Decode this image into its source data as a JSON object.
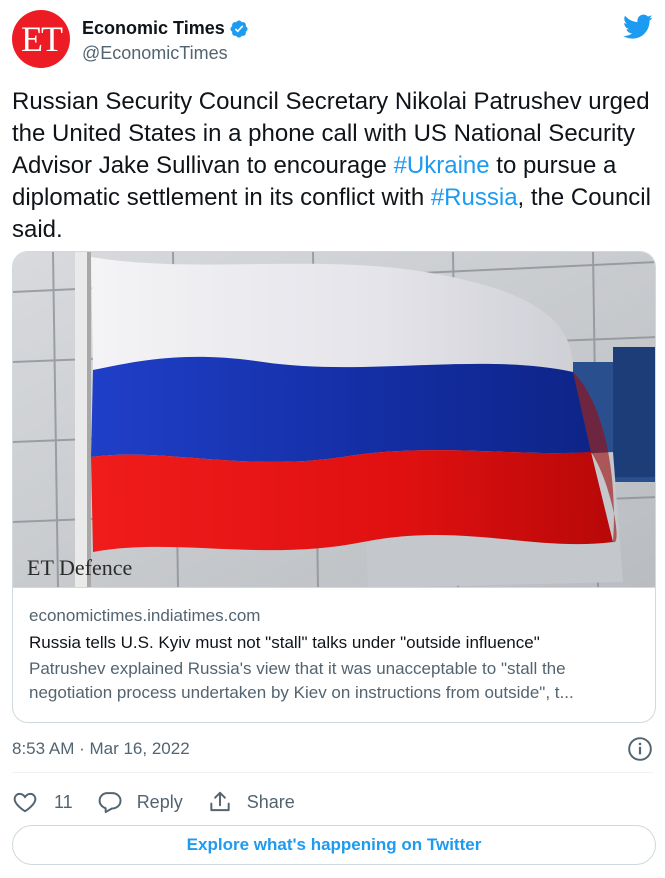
{
  "author": {
    "avatar_text": "ET",
    "display_name": "Economic Times",
    "handle": "@EconomicTimes",
    "verified_icon": "verified-badge-icon",
    "brand_color": "#ed1c24"
  },
  "tweet": {
    "text_parts": {
      "p1": "Russian Security Council Secretary Nikolai Patrushev urged the United States in a phone call with US National Security Advisor Jake Sullivan to encourage ",
      "hashtag1": "#Ukraine",
      "p2": " to pursue a diplomatic settlement in its conflict with ",
      "hashtag2": "#Russia",
      "p3": ", the Council said."
    }
  },
  "card": {
    "image_watermark": "ET Defence",
    "domain": "economictimes.indiatimes.com",
    "title": "Russia tells U.S. Kyiv must not \"stall\" talks under \"outside influence\"",
    "description": "Patrushev explained Russia's view that it was unacceptable to \"stall the negotiation process undertaken by Kiev on instructions from outside\", t..."
  },
  "meta": {
    "timestamp": "8:53 AM · Mar 16, 2022"
  },
  "actions": {
    "like_count": "11",
    "reply_label": "Reply",
    "share_label": "Share"
  },
  "explore_label": "Explore what's happening on Twitter",
  "colors": {
    "accent": "#1d9bf0",
    "text_secondary": "#536471",
    "border": "#cfd9de"
  }
}
